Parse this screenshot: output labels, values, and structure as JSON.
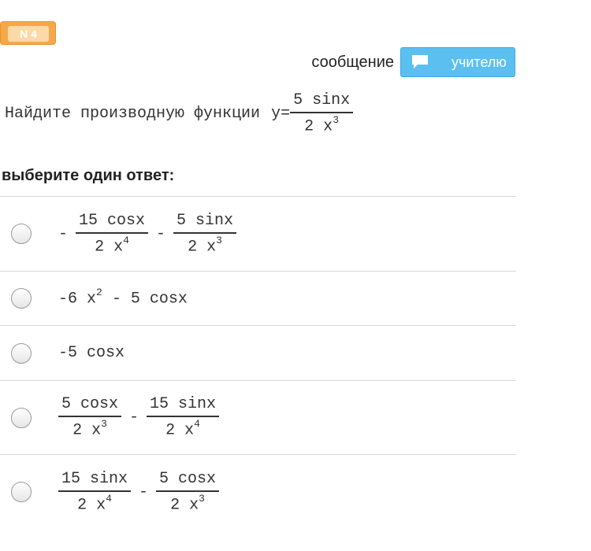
{
  "badge": {
    "label": "N 4"
  },
  "message": {
    "label": "сообщение",
    "button_label": "учителю",
    "icon": "chat-bubble-icon"
  },
  "question": {
    "text": "Найдите производную функции",
    "y": "y=",
    "num": "5 sinx",
    "den_base": "2 x",
    "den_exp": "3"
  },
  "choose_label": "выберите один ответ:",
  "options": [
    {
      "lead": "-",
      "f1": {
        "num": "15 cosx",
        "den_base": "2 x",
        "den_exp": "4"
      },
      "op": "-",
      "f2": {
        "num": "5 sinx",
        "den_base": "2 x",
        "den_exp": "3"
      }
    },
    {
      "t1": "-6 x",
      "exp": "2",
      "t2": " - 5 cosx"
    },
    {
      "text": "-5 cosx"
    },
    {
      "f1": {
        "num": "5 cosx",
        "den_base": "2 x",
        "den_exp": "3"
      },
      "op": "-",
      "f2": {
        "num": "15 sinx",
        "den_base": "2 x",
        "den_exp": "4"
      }
    },
    {
      "f1": {
        "num": "15 sinx",
        "den_base": "2 x",
        "den_exp": "4"
      },
      "op": "-",
      "f2": {
        "num": "5 cosx",
        "den_base": "2 x",
        "den_exp": "3"
      }
    }
  ]
}
